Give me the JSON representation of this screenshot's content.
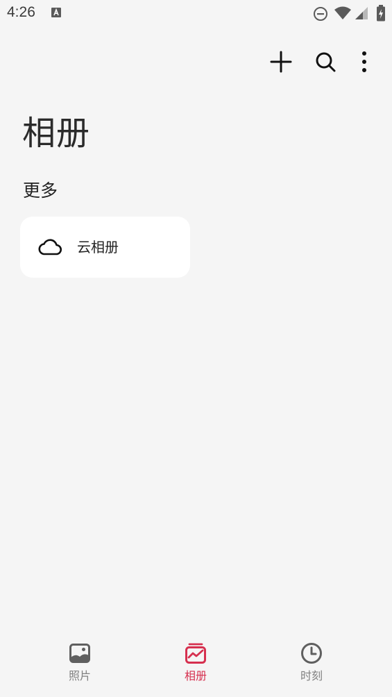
{
  "status_bar": {
    "time": "4:26",
    "icons": [
      "a-notification-icon",
      "do-not-disturb-icon",
      "wifi-icon",
      "signal-icon",
      "battery-charging-icon"
    ]
  },
  "toolbar": {
    "actions": [
      "add-icon",
      "search-icon",
      "more-vertical-icon"
    ]
  },
  "page": {
    "title": "相册",
    "section_label": "更多"
  },
  "albums": [
    {
      "icon": "cloud-icon",
      "label": "云相册"
    }
  ],
  "bottom_nav": {
    "items": [
      {
        "icon": "photos-icon",
        "label": "照片",
        "active": false
      },
      {
        "icon": "albums-icon",
        "label": "相册",
        "active": true
      },
      {
        "icon": "clock-icon",
        "label": "时刻",
        "active": false
      }
    ]
  },
  "colors": {
    "background": "#f5f5f5",
    "card": "#ffffff",
    "accent": "#d6304f",
    "inactive": "#808080"
  }
}
